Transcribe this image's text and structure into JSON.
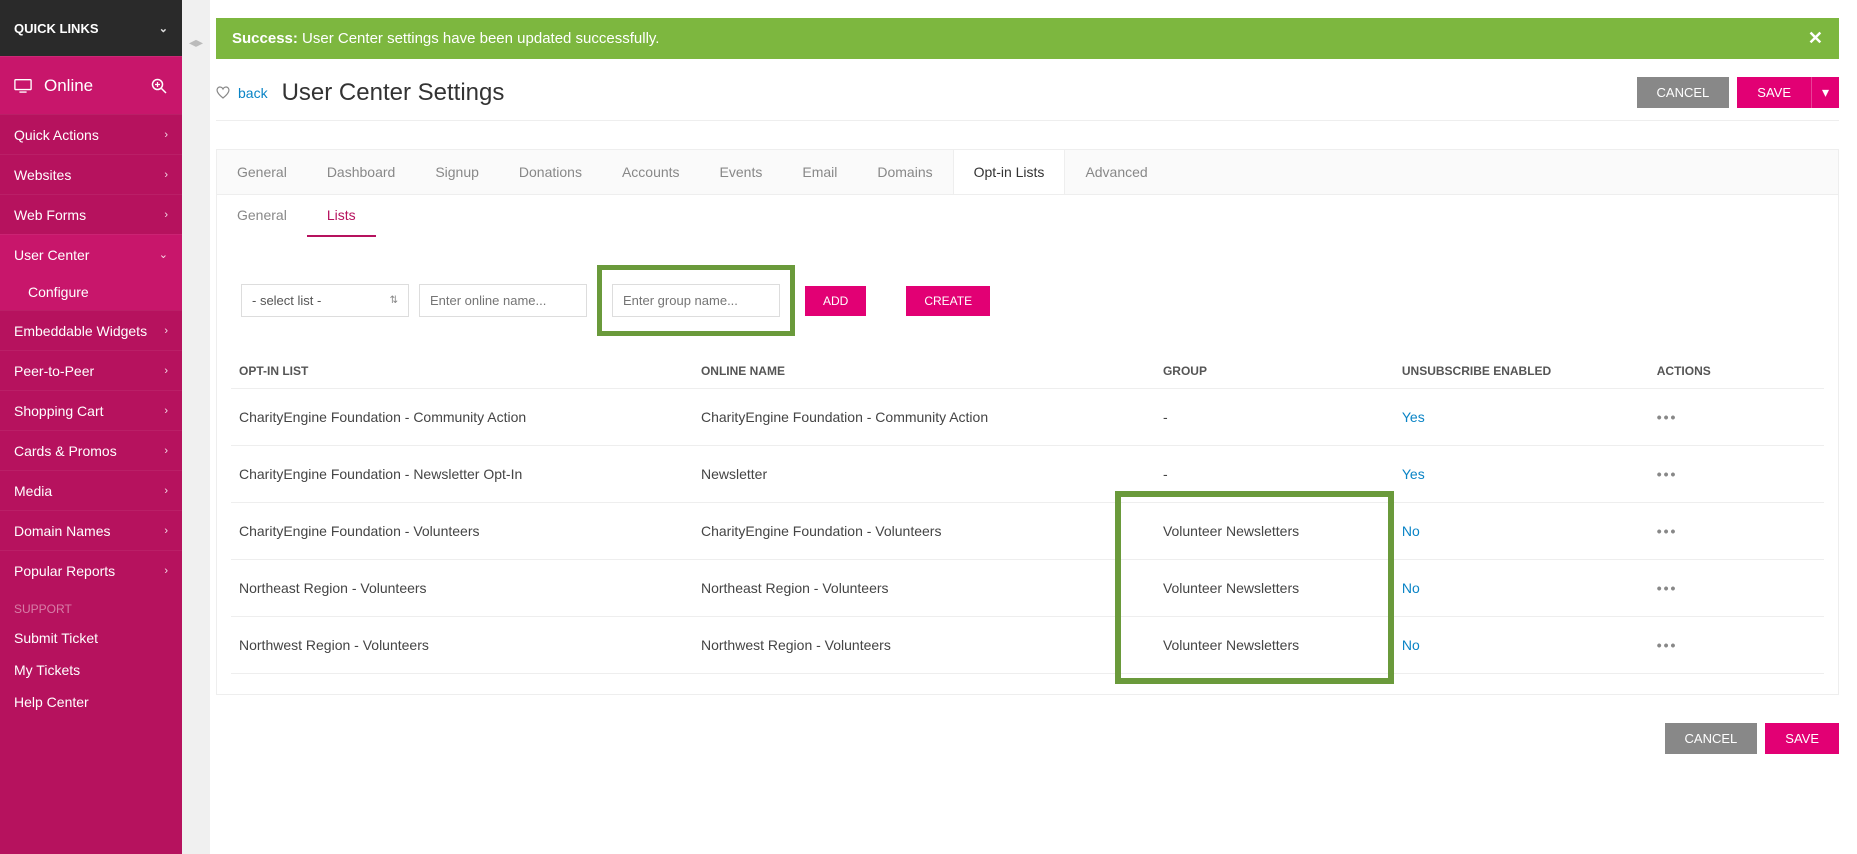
{
  "sidebar": {
    "quicklinks": "QUICK LINKS",
    "online": "Online",
    "items": [
      {
        "label": "Quick Actions"
      },
      {
        "label": "Websites"
      },
      {
        "label": "Web Forms"
      },
      {
        "label": "User Center"
      },
      {
        "label": "Embeddable Widgets"
      },
      {
        "label": "Peer-to-Peer"
      },
      {
        "label": "Shopping Cart"
      },
      {
        "label": "Cards & Promos"
      },
      {
        "label": "Media"
      },
      {
        "label": "Domain Names"
      },
      {
        "label": "Popular Reports"
      }
    ],
    "configure": "Configure",
    "support_header": "SUPPORT",
    "support": [
      {
        "label": "Submit Ticket"
      },
      {
        "label": "My Tickets"
      },
      {
        "label": "Help Center"
      }
    ]
  },
  "alert": {
    "prefix": "Success:",
    "message": " User Center settings have been updated successfully."
  },
  "page": {
    "back": "back",
    "title": "User Center Settings",
    "cancel": "CANCEL",
    "save": "SAVE"
  },
  "tabs_main": [
    "General",
    "Dashboard",
    "Signup",
    "Donations",
    "Accounts",
    "Events",
    "Email",
    "Domains",
    "Opt-in Lists",
    "Advanced"
  ],
  "tabs_main_active": 8,
  "tabs_sub": [
    "General",
    "Lists"
  ],
  "tabs_sub_active": 1,
  "form": {
    "select_placeholder": "- select list -",
    "online_name_placeholder": "Enter online name...",
    "group_name_placeholder": "Enter group name...",
    "add": "ADD",
    "create": "CREATE"
  },
  "table": {
    "headers": [
      "OPT-IN LIST",
      "ONLINE NAME",
      "GROUP",
      "UNSUBSCRIBE ENABLED",
      "ACTIONS"
    ],
    "rows": [
      {
        "list": "CharityEngine Foundation - Community Action",
        "online": "CharityEngine Foundation - Community Action",
        "group": "-",
        "unsub": "Yes"
      },
      {
        "list": "CharityEngine Foundation - Newsletter Opt-In",
        "online": "Newsletter",
        "group": "-",
        "unsub": "Yes"
      },
      {
        "list": "CharityEngine Foundation - Volunteers",
        "online": "CharityEngine Foundation - Volunteers",
        "group": "Volunteer Newsletters",
        "unsub": "No"
      },
      {
        "list": "Northeast Region - Volunteers",
        "online": "Northeast Region - Volunteers",
        "group": "Volunteer Newsletters",
        "unsub": "No"
      },
      {
        "list": "Northwest Region - Volunteers",
        "online": "Northwest Region - Volunteers",
        "group": "Volunteer Newsletters",
        "unsub": "No"
      }
    ]
  },
  "footer": {
    "cancel": "CANCEL",
    "save": "SAVE"
  }
}
